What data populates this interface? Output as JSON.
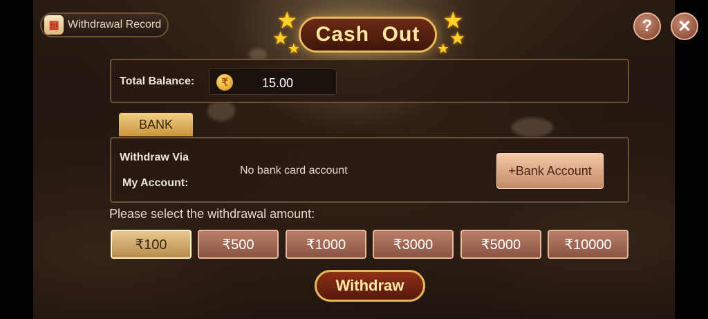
{
  "header": {
    "record_label": "Withdrawal Record",
    "record_icon": "calendar-icon",
    "title": "Cash  Out",
    "help_symbol": "?",
    "close_symbol": "✕"
  },
  "balance": {
    "label": "Total Balance:",
    "currency_symbol": "₹",
    "value": "15.00"
  },
  "method": {
    "tab_label": "BANK",
    "via_label": "Withdraw Via",
    "account_label": "My Account:",
    "no_account_text": "No bank card account",
    "add_account_label": "+Bank Account"
  },
  "amounts": {
    "prompt": "Please select the withdrawal amount:",
    "options": [
      "₹100",
      "₹500",
      "₹1000",
      "₹3000",
      "₹5000",
      "₹10000"
    ],
    "selected": "₹100"
  },
  "withdraw_label": "Withdraw",
  "colors": {
    "accent_gold": "#e9b85a",
    "button_rose": "#b87e68",
    "panel_border": "#6b5236"
  }
}
